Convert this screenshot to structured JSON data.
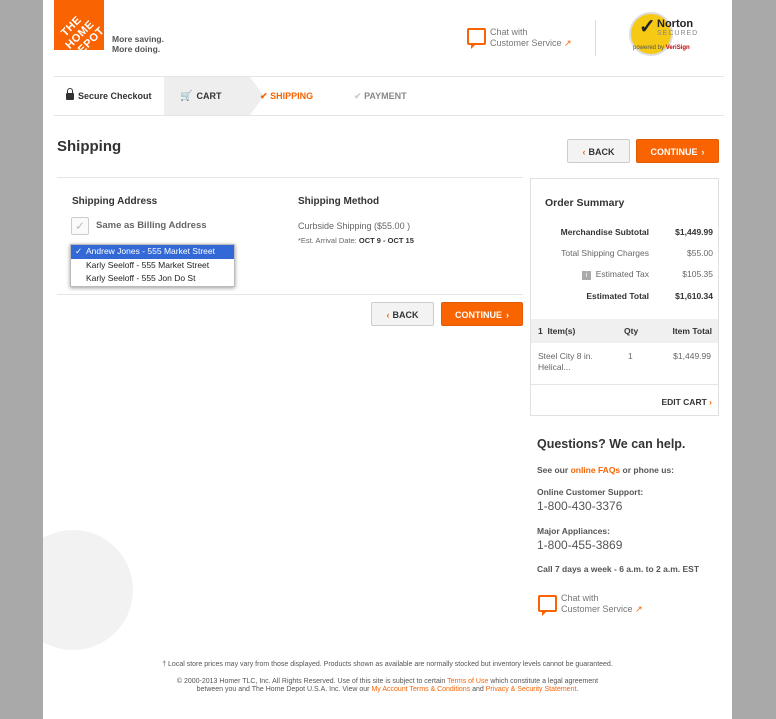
{
  "header": {
    "logo_text": "THE HOME DEPOT",
    "tagline_1": "More saving.",
    "tagline_2": "More doing.",
    "chat_line1": "Chat with",
    "chat_line2": "Customer Service",
    "norton_name": "Norton",
    "norton_secured": "SECURED",
    "norton_powered": "powered by",
    "norton_verisign": "VeriSign"
  },
  "steps": {
    "secure": "Secure Checkout",
    "cart": "CART",
    "shipping": "SHIPPING",
    "payment": "PAYMENT"
  },
  "page_title": "Shipping",
  "buttons": {
    "back": "BACK",
    "continue": "CONTINUE"
  },
  "shipping_address": {
    "heading": "Shipping Address",
    "same_as_billing": "Same as Billing Address",
    "options": [
      "Andrew Jones - 555 Market Street",
      "Karly Seeloff - 555 Market Street",
      "Karly Seeloff - 555 Jon Do St"
    ],
    "selected_mark": "✓"
  },
  "shipping_method": {
    "heading": "Shipping Method",
    "option": "Curbside Shipping ($55.00 )",
    "arrival_prefix": "*Est. Arrival Date:",
    "arrival_dates": "OCT 9 - OCT 15"
  },
  "order_summary": {
    "title": "Order Summary",
    "rows": [
      {
        "label": "Merchandise Subtotal",
        "value": "$1,449.99"
      },
      {
        "label": "Total Shipping Charges",
        "value": "$55.00"
      },
      {
        "label": "Estimated Tax",
        "value": "$105.35"
      },
      {
        "label": "Estimated Total",
        "value": "$1,610.34"
      }
    ],
    "items_header": {
      "count": "1",
      "items_label": "Item(s)",
      "qty": "Qty",
      "total": "Item Total"
    },
    "item": {
      "name_1": "Steel City 8 in.",
      "name_2": "Helical...",
      "qty": "1",
      "total": "$1,449.99"
    },
    "edit_cart": "EDIT CART"
  },
  "help": {
    "heading": "Questions? We can help.",
    "see_our": "See our",
    "faqs": "online FAQs",
    "or_phone": "or phone us:",
    "online_label": "Online Customer Support:",
    "online_phone": "1-800-430-3376",
    "appl_label": "Major Appliances:",
    "appl_phone": "1-800-455-3869",
    "hours": "Call 7 days a week - 6 a.m. to 2 a.m. EST",
    "chat_line1": "Chat with",
    "chat_line2": "Customer Service"
  },
  "footer": {
    "line1": "† Local store prices may vary from those displayed. Products shown as available are normally stocked but inventory levels cannot be guaranteed.",
    "line2a": "© 2000-2013 Homer TLC, Inc. All Rights Reserved. Use of this site is subject to certain",
    "terms": "Terms of Use",
    "line2b": "which constitute a legal agreement",
    "line3a": "between you and The Home Depot U.S.A. Inc. View our",
    "myaccount_terms": "My Account Terms & Conditions",
    "and": "and",
    "privacy": "Privacy & Security Statement",
    "period": "."
  },
  "colors": {
    "accent": "#f96302",
    "selection": "#3369d6"
  }
}
